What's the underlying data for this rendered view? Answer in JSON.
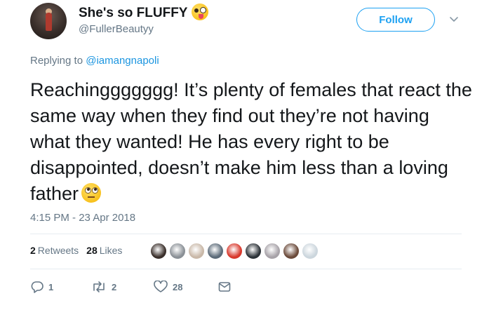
{
  "user": {
    "display_name": "She's so FLUFFY",
    "handle": "@FullerBeautyy",
    "name_emoji_icon": "zany-face-emoji"
  },
  "follow": {
    "label": "Follow"
  },
  "reply": {
    "prefix": "Replying to",
    "mention": "@iamangnapoli"
  },
  "tweet": {
    "text": "Reachinggggggg! It’s plenty of females that react the same way when they find out they’re not having what they wanted! He has every right to be disappointed, doesn’t make him less than a loving father",
    "trailing_emoji_icon": "face-with-rolling-eyes-emoji",
    "timestamp": "4:15 PM - 23 Apr 2018"
  },
  "stats": {
    "retweets_count": "2",
    "retweets_label": "Retweets",
    "likes_count": "28",
    "likes_label": "Likes",
    "liker_avatar_colors": [
      "#3a2f2b",
      "#8a9096",
      "#c9b8a8",
      "#5b6a78",
      "#d8382c",
      "#2c3238",
      "#a7a2a8",
      "#6b4a3a",
      "#ccd6dd"
    ]
  },
  "actions": {
    "reply_count": "1",
    "retweet_count": "2",
    "like_count": "28"
  },
  "colors": {
    "accent": "#1da1f2",
    "secondary_text": "#657786"
  }
}
